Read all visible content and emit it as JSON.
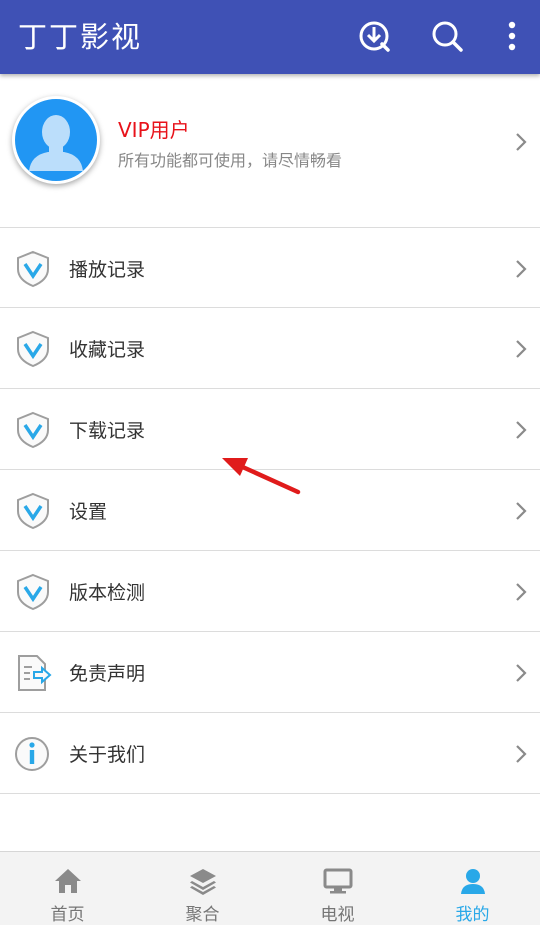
{
  "app": {
    "title": "丁丁影视"
  },
  "toolbar": {
    "icons": [
      "download-icon",
      "search-icon",
      "more-vert-icon"
    ]
  },
  "profile": {
    "level": "VIP用户",
    "description": "所有功能都可使用，请尽情畅看",
    "level_color": "#e8121a"
  },
  "menu": [
    {
      "label": "播放记录",
      "icon": "shield-v-icon"
    },
    {
      "label": "收藏记录",
      "icon": "shield-v-icon"
    },
    {
      "label": "下载记录",
      "icon": "shield-v-icon"
    },
    {
      "label": "设置",
      "icon": "shield-v-icon"
    },
    {
      "label": "版本检测",
      "icon": "shield-v-icon"
    },
    {
      "label": "免责声明",
      "icon": "document-share-icon"
    },
    {
      "label": "关于我们",
      "icon": "info-icon"
    }
  ],
  "tabs": [
    {
      "label": "首页",
      "icon": "home-icon",
      "active": false
    },
    {
      "label": "聚合",
      "icon": "layers-icon",
      "active": false
    },
    {
      "label": "电视",
      "icon": "tv-icon",
      "active": false
    },
    {
      "label": "我的",
      "icon": "person-icon",
      "active": true
    }
  ],
  "colors": {
    "primary": "#3f51b5",
    "accent": "#29a8e8",
    "avatar": "#2196f3"
  }
}
